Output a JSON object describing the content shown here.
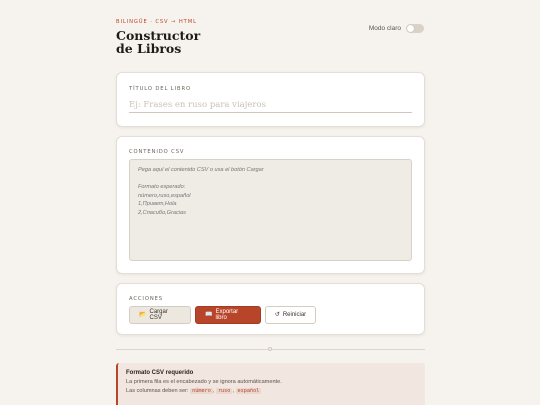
{
  "header": {
    "eyebrow": "BILINGÜE · CSV → HTML",
    "title": "Constructor de Libros",
    "mode_label": "Modo claro"
  },
  "title_card": {
    "label": "TÍTULO DEL LIBRO",
    "placeholder": "Ej: Frases en ruso para viajeros",
    "value": ""
  },
  "csv_card": {
    "label": "CONTENIDO CSV",
    "placeholder": "Pega aquí el contenido CSV o usa el botón Cargar\n\nFormato esperado:\nnúmero,ruso,español\n1,Привет,Hola\n2,Спасибо,Gracias",
    "value": ""
  },
  "actions_card": {
    "label": "ACCIONES",
    "load_label": "Cargar CSV",
    "load_icon": "folder-icon",
    "export_label": "Exportar libro",
    "export_icon": "book-icon",
    "reset_label": "Reiniciar",
    "reset_icon": "refresh-icon"
  },
  "note": {
    "title": "Formato CSV requerido",
    "line1": "La primera fila es el encabezado y se ignora automáticamente.",
    "line2_prefix": "Las columnas deben ser:",
    "columns": [
      "número",
      "ruso",
      "español"
    ]
  },
  "colors": {
    "accent": "#b8452a",
    "background": "#f6f3ee",
    "card": "#ffffff"
  }
}
